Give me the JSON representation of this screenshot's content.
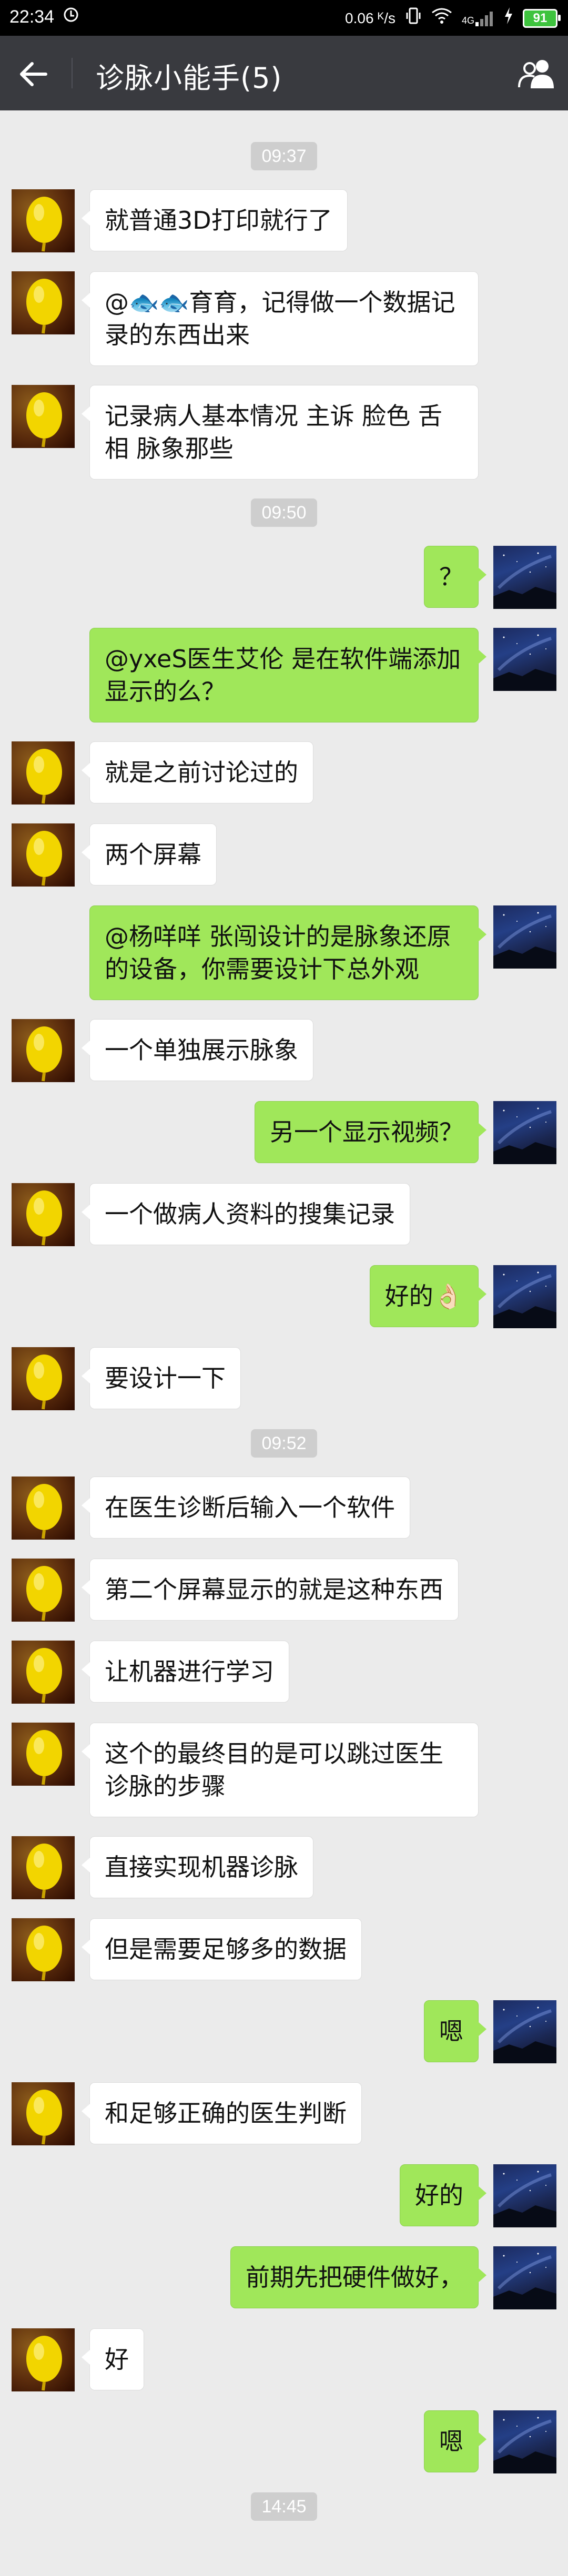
{
  "status_bar": {
    "time": "22:34",
    "speed": "0.06 ᴷ/s",
    "signal": "4G",
    "battery": "91"
  },
  "header": {
    "title": "诊脉小能手(5)"
  },
  "colors": {
    "header_bg": "#393a3f",
    "chat_bg": "#ebebeb",
    "outgoing_bubble": "#a0e75a",
    "incoming_bubble": "#ffffff"
  },
  "messages": [
    {
      "kind": "time",
      "text": "09:37"
    },
    {
      "kind": "msg",
      "side": "left",
      "text": "就普通3D打印就行了"
    },
    {
      "kind": "msg",
      "side": "left",
      "text": "@🐟🐟育育，记得做一个数据记录的东西出来"
    },
    {
      "kind": "msg",
      "side": "left",
      "text": "记录病人基本情况 主诉 脸色 舌相 脉象那些"
    },
    {
      "kind": "time",
      "text": "09:50"
    },
    {
      "kind": "msg",
      "side": "right",
      "text": "？"
    },
    {
      "kind": "msg",
      "side": "right",
      "text": "@yxeS医生艾伦 是在软件端添加显示的么？"
    },
    {
      "kind": "msg",
      "side": "left",
      "text": "就是之前讨论过的"
    },
    {
      "kind": "msg",
      "side": "left",
      "text": "两个屏幕"
    },
    {
      "kind": "msg",
      "side": "right",
      "text": "@杨咩咩 张闯设计的是脉象还原的设备，你需要设计下总外观"
    },
    {
      "kind": "msg",
      "side": "left",
      "text": "一个单独展示脉象"
    },
    {
      "kind": "msg",
      "side": "right",
      "text": "另一个显示视频？"
    },
    {
      "kind": "msg",
      "side": "left",
      "text": "一个做病人资料的搜集记录"
    },
    {
      "kind": "msg",
      "side": "right",
      "text": "好的👌🏻"
    },
    {
      "kind": "msg",
      "side": "left",
      "text": "要设计一下"
    },
    {
      "kind": "time",
      "text": "09:52"
    },
    {
      "kind": "msg",
      "side": "left",
      "text": "在医生诊断后输入一个软件"
    },
    {
      "kind": "msg",
      "side": "left",
      "text": "第二个屏幕显示的就是这种东西"
    },
    {
      "kind": "msg",
      "side": "left",
      "text": "让机器进行学习"
    },
    {
      "kind": "msg",
      "side": "left",
      "text": "这个的最终目的是可以跳过医生诊脉的步骤"
    },
    {
      "kind": "msg",
      "side": "left",
      "text": "直接实现机器诊脉"
    },
    {
      "kind": "msg",
      "side": "left",
      "text": "但是需要足够多的数据"
    },
    {
      "kind": "msg",
      "side": "right",
      "text": "嗯"
    },
    {
      "kind": "msg",
      "side": "left",
      "text": "和足够正确的医生判断"
    },
    {
      "kind": "msg",
      "side": "right",
      "text": "好的"
    },
    {
      "kind": "msg",
      "side": "right",
      "text": "前期先把硬件做好，"
    },
    {
      "kind": "msg",
      "side": "left",
      "text": "好"
    },
    {
      "kind": "msg",
      "side": "right",
      "text": "嗯"
    },
    {
      "kind": "time",
      "text": "14:45"
    }
  ]
}
